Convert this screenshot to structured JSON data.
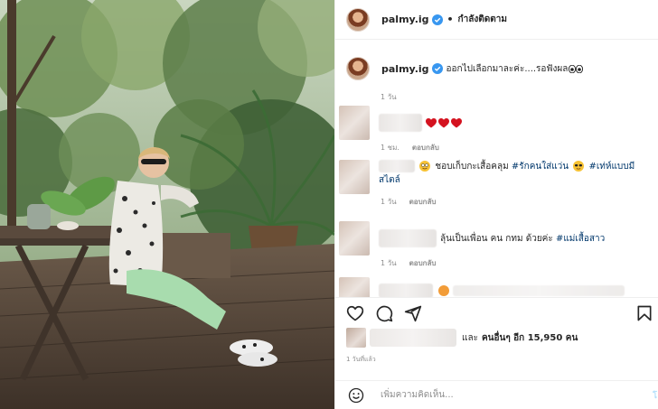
{
  "header": {
    "username": "palmy.ig",
    "separator": "•",
    "follow_state": "กำลังติดตาม"
  },
  "caption": {
    "username": "palmy.ig",
    "text": "ออกไปเลือกมาละค่ะ....รอฟังผล",
    "time": "1 วัน"
  },
  "comments": [
    {
      "text": "",
      "time": "1 ชม.",
      "reply": "ตอบกลับ"
    },
    {
      "text_before": "ชอบเก็บกะเสื้อคลุม ",
      "tag1": "#รักคนใส่แว่น",
      "tag2": "#เท่ห์แบบมีสไตล์",
      "time": "1 วัน",
      "reply": "ตอบกลับ"
    },
    {
      "text": "ลุ้นเป็นเพื่อน คน กทม ด้วยค่ะ ",
      "tag": "#แม่เสื้อสาว",
      "time": "1 วัน",
      "reply": "ตอบกลับ"
    },
    {
      "text": "..."
    }
  ],
  "likes": {
    "connector": "และ",
    "bold_text": "คนอื่นๆ อีก 15,950 คน"
  },
  "posted_time": "1 วันที่แล้ว",
  "add_comment": {
    "placeholder": "เพิ่มความคิดเห็น...",
    "post_label": "โ"
  },
  "colors": {
    "verified": "#3897f0",
    "hashtag": "#00376b",
    "meta": "#8e8e8e"
  },
  "icons": [
    "verified-icon",
    "heart-icon",
    "comment-icon",
    "share-icon",
    "bookmark-icon",
    "emoji-icon"
  ]
}
